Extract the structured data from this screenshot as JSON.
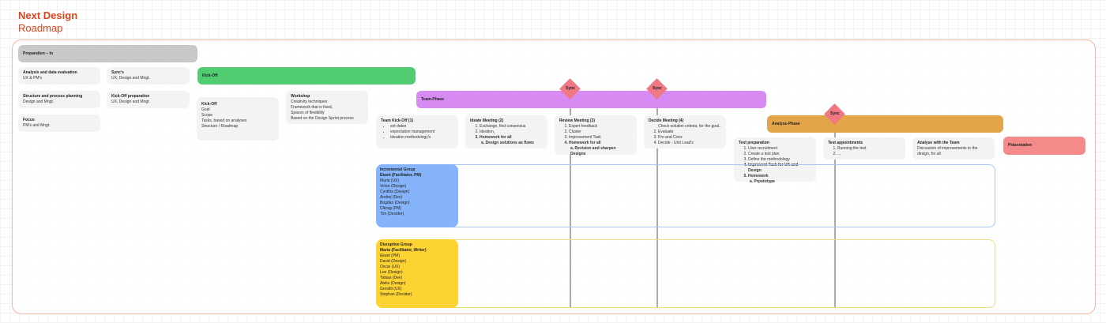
{
  "header": {
    "title": "Next Design",
    "subtitle": "Roadmap"
  },
  "bars": {
    "prep": "Preparation – to",
    "kickoff": "Kick-Off",
    "team": "Team-Phase",
    "analyse": "Analyse-Phase",
    "presentation": "Präsentation"
  },
  "sync_label": "Sync",
  "prep_cards": {
    "analysis": {
      "title": "Analysis and data evaluation",
      "text": "UX & PM's"
    },
    "syncs": {
      "title": "Sync's",
      "text": "UX, Design and Mngt."
    },
    "structure": {
      "title": "Structure and process planning",
      "text": "Design and Mngt."
    },
    "kickoff_prep": {
      "title": "Kick-Off preparation",
      "text": "UX, Design and Mngt."
    },
    "focus": {
      "title": "Focus",
      "text": "PM's and Mngt."
    }
  },
  "kickoff_card": {
    "title": "Kick-Off",
    "lines": [
      "Goal",
      "Scope",
      "Tasks, based on analyses",
      "Structure / Roadmap"
    ]
  },
  "workshop_card": {
    "title": "Workshop",
    "lines": [
      "Creativity techniques",
      "Framework that is fixed,",
      "Spaces of flexibility",
      "Based on the Design Sprint process"
    ]
  },
  "team_cards": {
    "kickoff": {
      "title": "Team Kick-Off (1)",
      "items": [
        "set dates",
        "expectation management",
        "Ideation methodology's"
      ]
    },
    "ideate": {
      "title": "Ideate Meeting (2)",
      "items": [
        "Exchange, find consensus",
        "Ideation,",
        "Homework for all"
      ],
      "sub": "a.  Design solutions as flows"
    },
    "review": {
      "title": "Review Meeting (3)",
      "items": [
        "Expert feedback",
        "Cluster",
        "Improvement Task",
        "Homework for all"
      ],
      "sub": "a.  Revision and sharpen Designs"
    },
    "decide": {
      "title": "Decide Meeting (4)",
      "items": [
        "Check solution criteria, for the goal...",
        "Evaluate",
        "Pro and Cons",
        "Decide - Unit Lead's"
      ]
    }
  },
  "analyse_cards": {
    "test_prep": {
      "title": "Test preparation",
      "items": [
        "User recruitment",
        "Create a test plan",
        "Define the methodology",
        "Improvent Task for UX and Design",
        "Homework"
      ],
      "sub": "a.  Prpototype"
    },
    "test_appointments": {
      "title": "Test appointments",
      "items": [
        "Running the test",
        "..."
      ]
    },
    "analyse_team": {
      "title": "Analyse with the Team",
      "lines": [
        "Discussion of improvements to the",
        "design, for all"
      ]
    }
  },
  "groups": {
    "incremental": {
      "title": "Incremental Group",
      "lead": "Ekant (Facilitator, PM)",
      "members": [
        "Maria (UX)",
        "Victor (Design)",
        "Cynthia (Design)",
        "Andrej (Dev)",
        "Bogdan (Design)",
        "Chirag (PM)",
        "Tim (Decider)"
      ]
    },
    "disruptive": {
      "title": "Disruptive Group",
      "lead": "Maria (Facilitator, Writer)",
      "members": [
        "Ekant (PM)",
        "David (Design)",
        "Oscar (UX)",
        "Lee (Design)",
        "Tobias (Dev)",
        "Aleks (Design)",
        "Gorsitti (UX)",
        "Stephan (Decider)"
      ]
    }
  },
  "colors": {
    "title": "#e0431b",
    "prep": "#c8c8c8",
    "kickoff": "#52cc73",
    "team": "#d68af2",
    "analyse": "#e3a44a",
    "presentation": "#f58a8a",
    "sync": "#f07884",
    "incremental": "#85b4fb",
    "disruptive": "#fdd334"
  }
}
